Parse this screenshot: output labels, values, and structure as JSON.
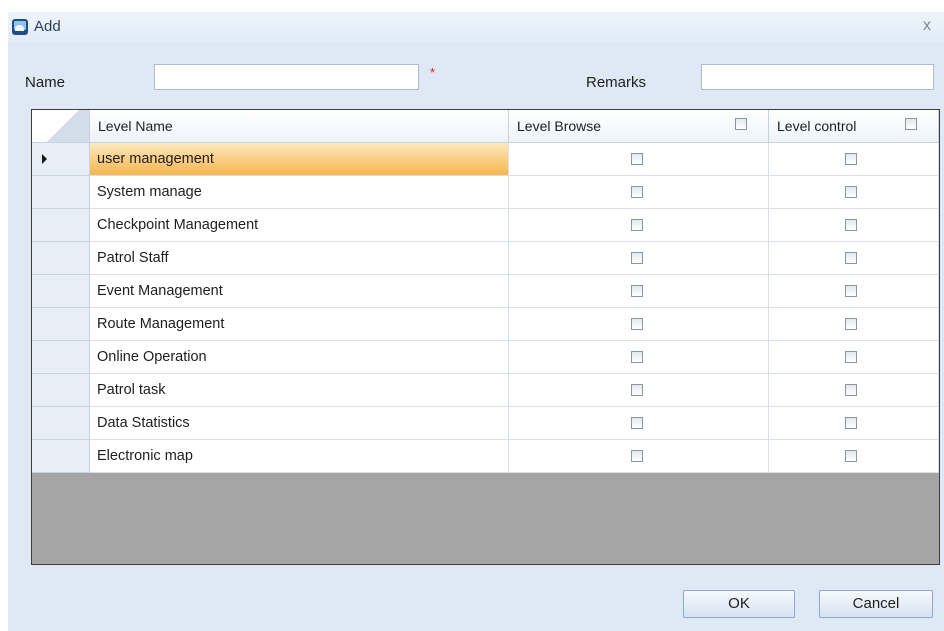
{
  "window": {
    "title": "Add",
    "close_glyph": "x"
  },
  "form": {
    "name_label": "Name",
    "name_value": "",
    "name_required_mark": "*",
    "remarks_label": "Remarks",
    "remarks_value": ""
  },
  "grid": {
    "columns": [
      "Level Name",
      "Level Browse",
      "Level control"
    ],
    "header_checks": {
      "level_browse": false,
      "level_control": false
    },
    "rows": [
      {
        "name": "user management",
        "browse": false,
        "control": false,
        "selected": true
      },
      {
        "name": "System manage",
        "browse": false,
        "control": false
      },
      {
        "name": "Checkpoint Management",
        "browse": false,
        "control": false
      },
      {
        "name": "Patrol Staff",
        "browse": false,
        "control": false
      },
      {
        "name": "Event Management",
        "browse": false,
        "control": false
      },
      {
        "name": "Route Management",
        "browse": false,
        "control": false
      },
      {
        "name": "Online Operation",
        "browse": false,
        "control": false
      },
      {
        "name": "Patrol task",
        "browse": false,
        "control": false
      },
      {
        "name": "Data Statistics",
        "browse": false,
        "control": false
      },
      {
        "name": "Electronic map",
        "browse": false,
        "control": false
      }
    ]
  },
  "buttons": {
    "ok": "OK",
    "cancel": "Cancel"
  },
  "colors": {
    "dialog_background": "#dfe9f5",
    "selected_row": "#f7b54d",
    "grid_empty_area": "#a5a5a5",
    "required_mark": "#e0201b"
  },
  "icons": {
    "app": "app-window-icon",
    "close": "close-icon"
  }
}
